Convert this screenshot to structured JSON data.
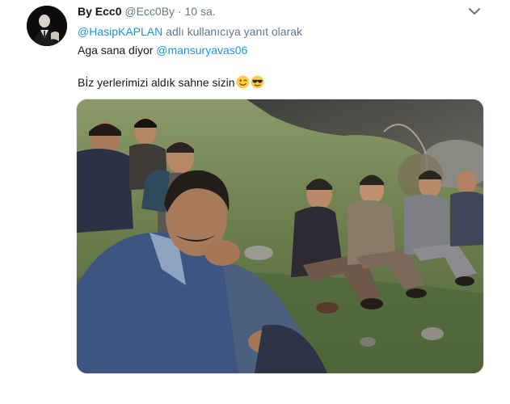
{
  "tweet": {
    "author_name": "By Ecc0",
    "handle": "@Ecc0By",
    "separator": "·",
    "timestamp": "10 sa.",
    "reply_to_handle": "@HasipKAPLAN",
    "reply_suffix": " adlı kullanıcıya yanıt olarak",
    "line1_text": "Aga sana diyor ",
    "line1_mention": "@mansuryavas06",
    "line2_text": "Bİz yerlerimizi aldık sahne sizin",
    "emojis": [
      "winking-face-emoji",
      "sunglasses-face-emoji"
    ]
  },
  "colors": {
    "link": "#1b95e0",
    "secondary_text": "#657786",
    "primary_text": "#14171a",
    "emoji_yellow": "#ffcc4d"
  },
  "icons": {
    "menu": "chevron-down-icon"
  }
}
